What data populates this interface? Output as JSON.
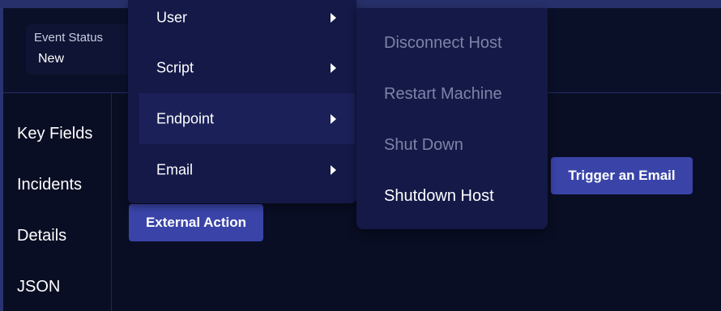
{
  "event_status": {
    "label": "Event Status",
    "value": "New"
  },
  "sidebar": {
    "items": [
      {
        "label": "Key Fields"
      },
      {
        "label": "Incidents"
      },
      {
        "label": "Details"
      },
      {
        "label": "JSON"
      }
    ]
  },
  "buttons": {
    "external_action": "External Action",
    "trigger_email": "Trigger an Email"
  },
  "menu": {
    "items": [
      {
        "label": "User",
        "has_submenu": true,
        "active": false
      },
      {
        "label": "Script",
        "has_submenu": true,
        "active": false
      },
      {
        "label": "Endpoint",
        "has_submenu": true,
        "active": true
      },
      {
        "label": "Email",
        "has_submenu": true,
        "active": false
      }
    ]
  },
  "submenu": {
    "items": [
      {
        "label": "Disconnect Host",
        "enabled": false
      },
      {
        "label": "Restart Machine",
        "enabled": false
      },
      {
        "label": "Shut Down",
        "enabled": false
      },
      {
        "label": "Shutdown Host",
        "enabled": true
      }
    ]
  },
  "colors": {
    "background": "#0a0e24",
    "menu_background": "#141948",
    "menu_active": "#1b2158",
    "button_accent": "#3a44a8",
    "disabled_text": "#7f83a6"
  }
}
